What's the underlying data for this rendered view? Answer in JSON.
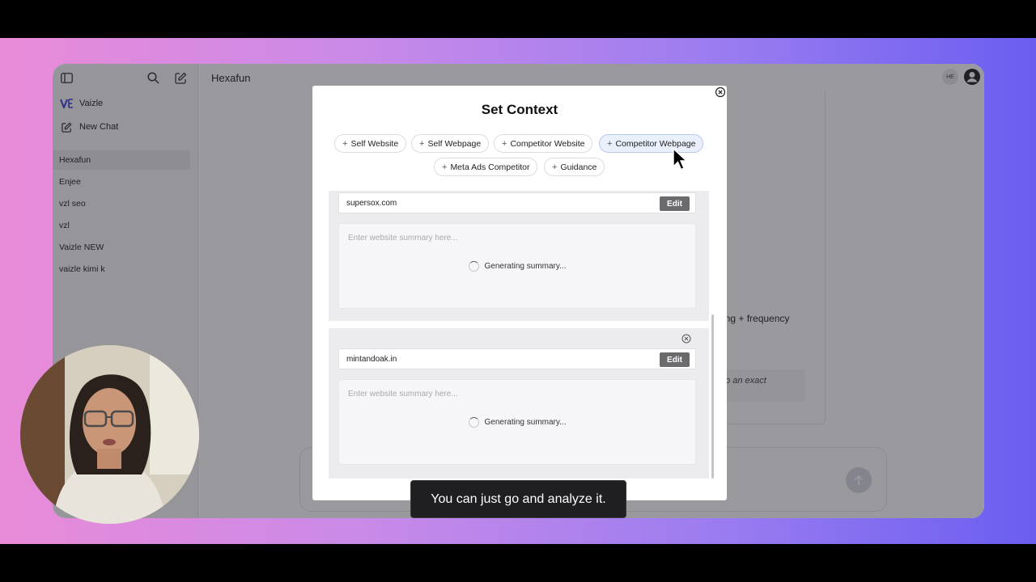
{
  "sidebar": {
    "brand": "Vaizle",
    "new_chat": "New Chat",
    "chats": [
      "Hexafun",
      "Enjee",
      "vzl seo",
      "vzl",
      "Vaizle NEW",
      "vaizle kimi k"
    ]
  },
  "header": {
    "title": "Hexafun",
    "avatar_initials": "HE"
  },
  "background_chat": {
    "visible_text": "ing + frequency",
    "italic_text": "to an exact"
  },
  "modal": {
    "title": "Set Context",
    "chips": [
      {
        "label": "Self Website",
        "active": false
      },
      {
        "label": "Self Webpage",
        "active": false
      },
      {
        "label": "Competitor Website",
        "active": false
      },
      {
        "label": "Competitor Webpage",
        "active": true
      },
      {
        "label": "Meta Ads Competitor",
        "active": false
      },
      {
        "label": "Guidance",
        "active": false
      }
    ],
    "entries": [
      {
        "url": "supersox.com",
        "edit": "Edit",
        "placeholder": "Enter website summary here...",
        "status": "Generating summary..."
      },
      {
        "url": "mintandoak.in",
        "edit": "Edit",
        "placeholder": "Enter website summary here...",
        "status": "Generating summary..."
      }
    ]
  },
  "caption": "You can just go and analyze it.",
  "colors": {
    "accent_chip_bg": "#eaf0fb",
    "edit_button": "#6b6b6e"
  }
}
